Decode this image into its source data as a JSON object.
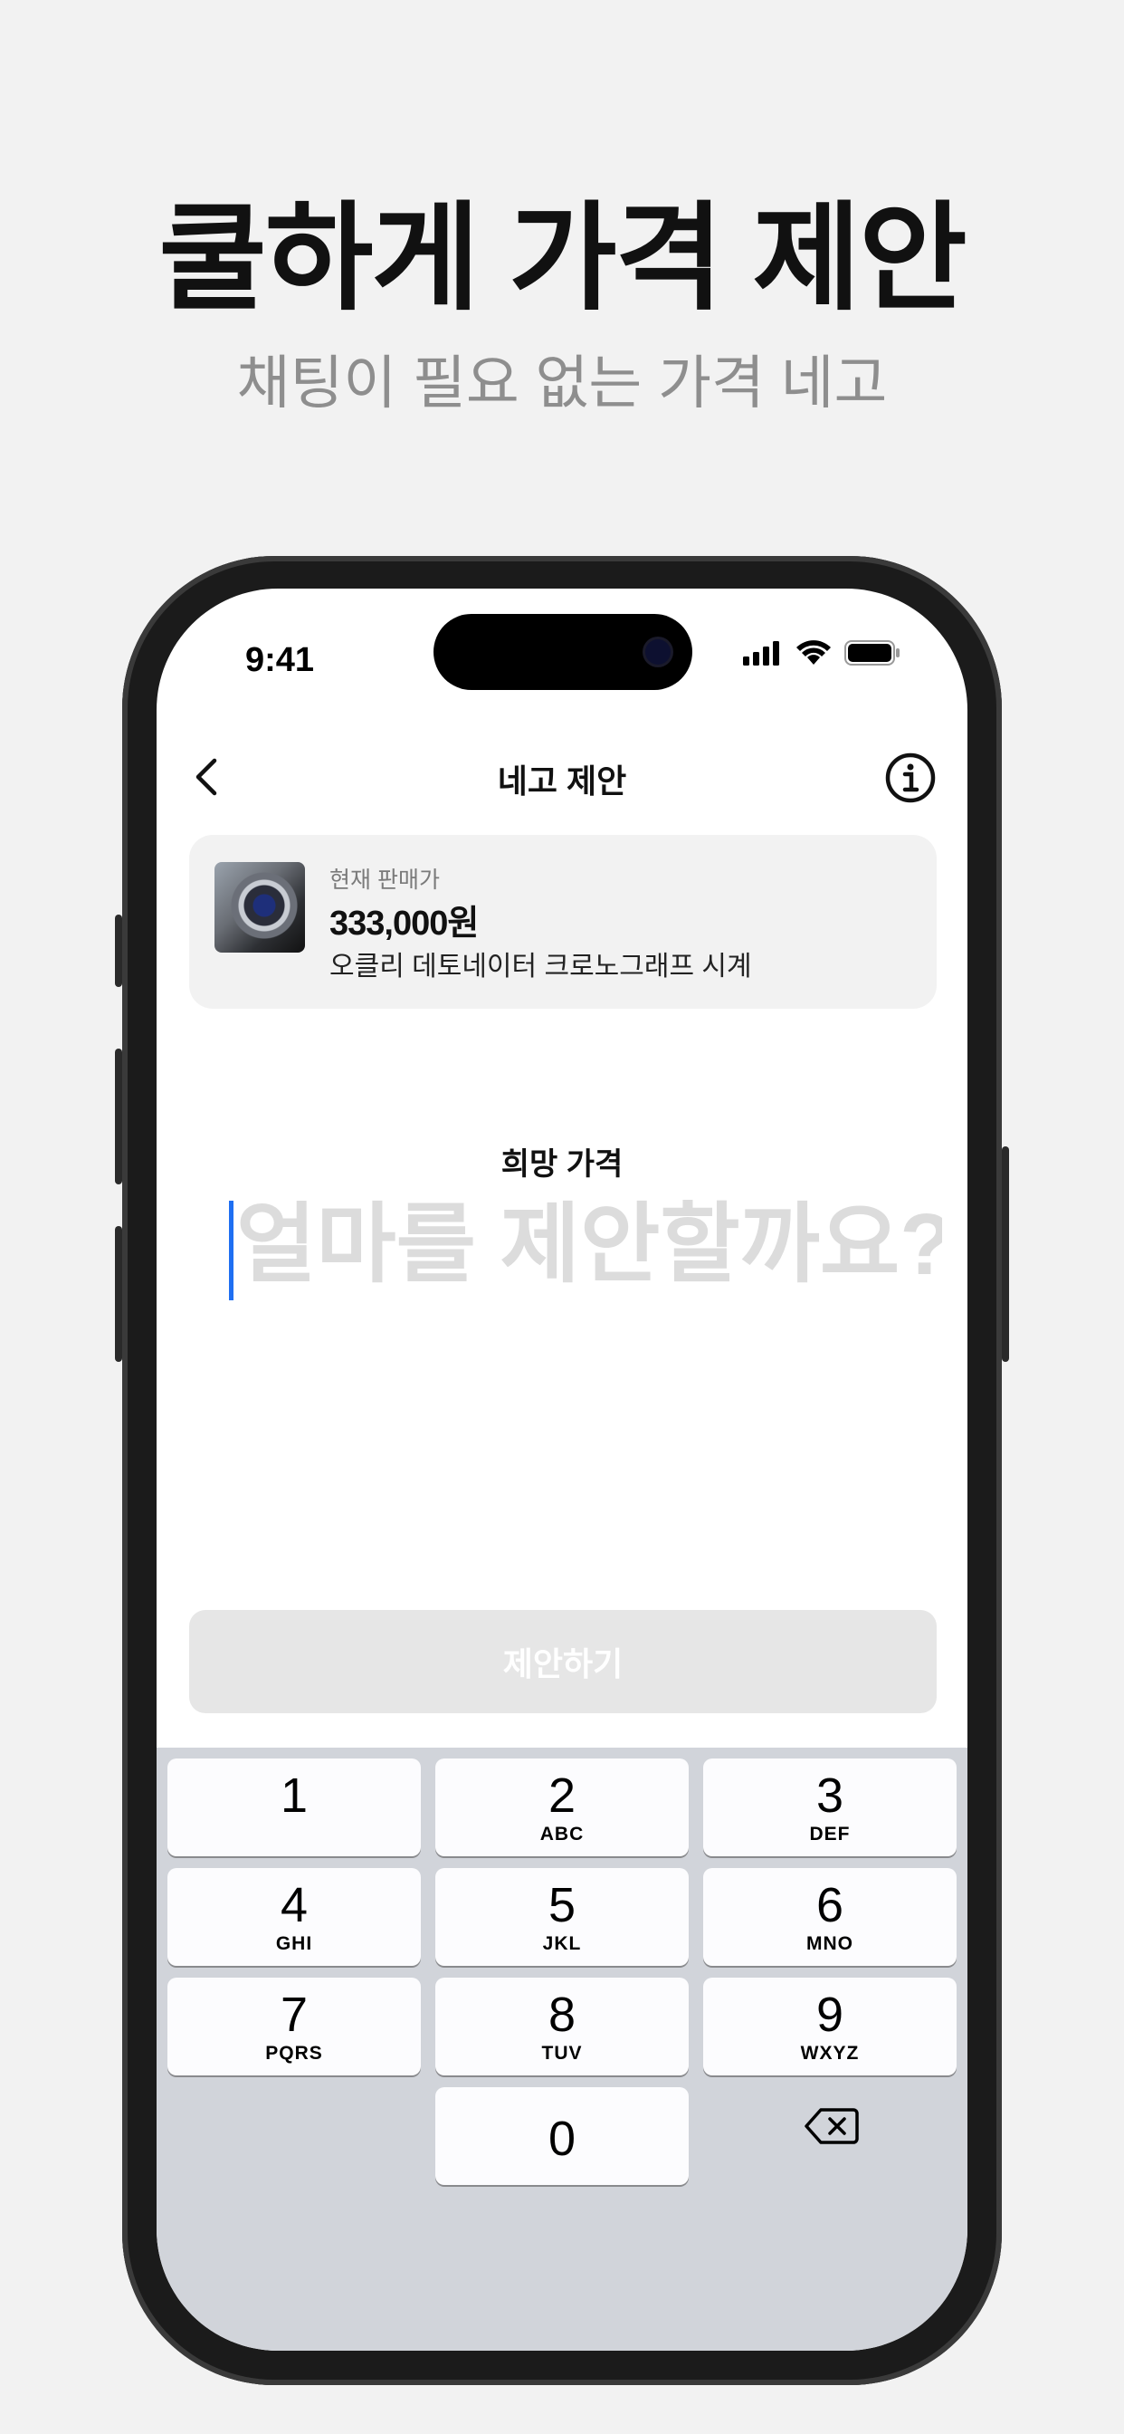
{
  "promo": {
    "title": "쿨하게 가격 제안",
    "subtitle": "채팅이 필요 없는 가격 네고"
  },
  "status_bar": {
    "time": "9:41"
  },
  "header": {
    "title": "네고 제안"
  },
  "product": {
    "price_label": "현재 판매가",
    "price": "333,000원",
    "name": "오클리 데토네이터 크로노그래프 시계"
  },
  "offer": {
    "label": "희망 가격",
    "placeholder": "얼마를 제안할까요?",
    "value": ""
  },
  "submit_label": "제안하기",
  "keypad": {
    "keys": [
      {
        "num": "1",
        "letters": ""
      },
      {
        "num": "2",
        "letters": "ABC"
      },
      {
        "num": "3",
        "letters": "DEF"
      },
      {
        "num": "4",
        "letters": "GHI"
      },
      {
        "num": "5",
        "letters": "JKL"
      },
      {
        "num": "6",
        "letters": "MNO"
      },
      {
        "num": "7",
        "letters": "PQRS"
      },
      {
        "num": "8",
        "letters": "TUV"
      },
      {
        "num": "9",
        "letters": "WXYZ"
      },
      {
        "num": "0",
        "letters": ""
      }
    ]
  },
  "colors": {
    "accent_caret": "#1f6ff2",
    "keypad_bg": "#d1d4da",
    "card_bg": "#f2f2f2"
  }
}
